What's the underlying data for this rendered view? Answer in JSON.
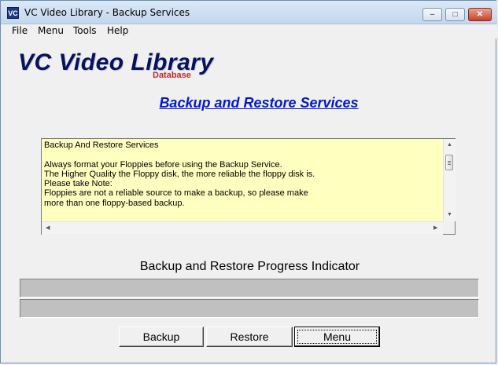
{
  "window": {
    "title": "VC Video Library - Backup Services",
    "icon_text": "VC",
    "controls": {
      "minimize": "‒",
      "maximize": "□",
      "close": "✕"
    }
  },
  "menubar": {
    "items": [
      "File",
      "Menu",
      "Tools",
      "Help"
    ]
  },
  "logo": {
    "main": "VC Video Library",
    "sub": "Database"
  },
  "heading": "Backup and Restore Services",
  "textarea": {
    "content": "Backup And Restore Services\n\nAlways format your Floppies before using the Backup Service.\nThe Higher Quality the Floppy disk, the more reliable the floppy disk is.\nPlease take Note:\nFloppies are not a reliable source to make a backup, so please make\nmore than one floppy-based backup."
  },
  "progress": {
    "title": "Backup and Restore Progress Indicator",
    "bars": [
      {
        "value": 0
      },
      {
        "value": 0
      }
    ]
  },
  "buttons": {
    "backup": "Backup",
    "restore": "Restore",
    "menu": "Menu"
  },
  "colors": {
    "heading": "#0018d6",
    "textarea_bg": "#ffffc0",
    "logo": "#08125c",
    "logo_sub": "#c1272d"
  }
}
